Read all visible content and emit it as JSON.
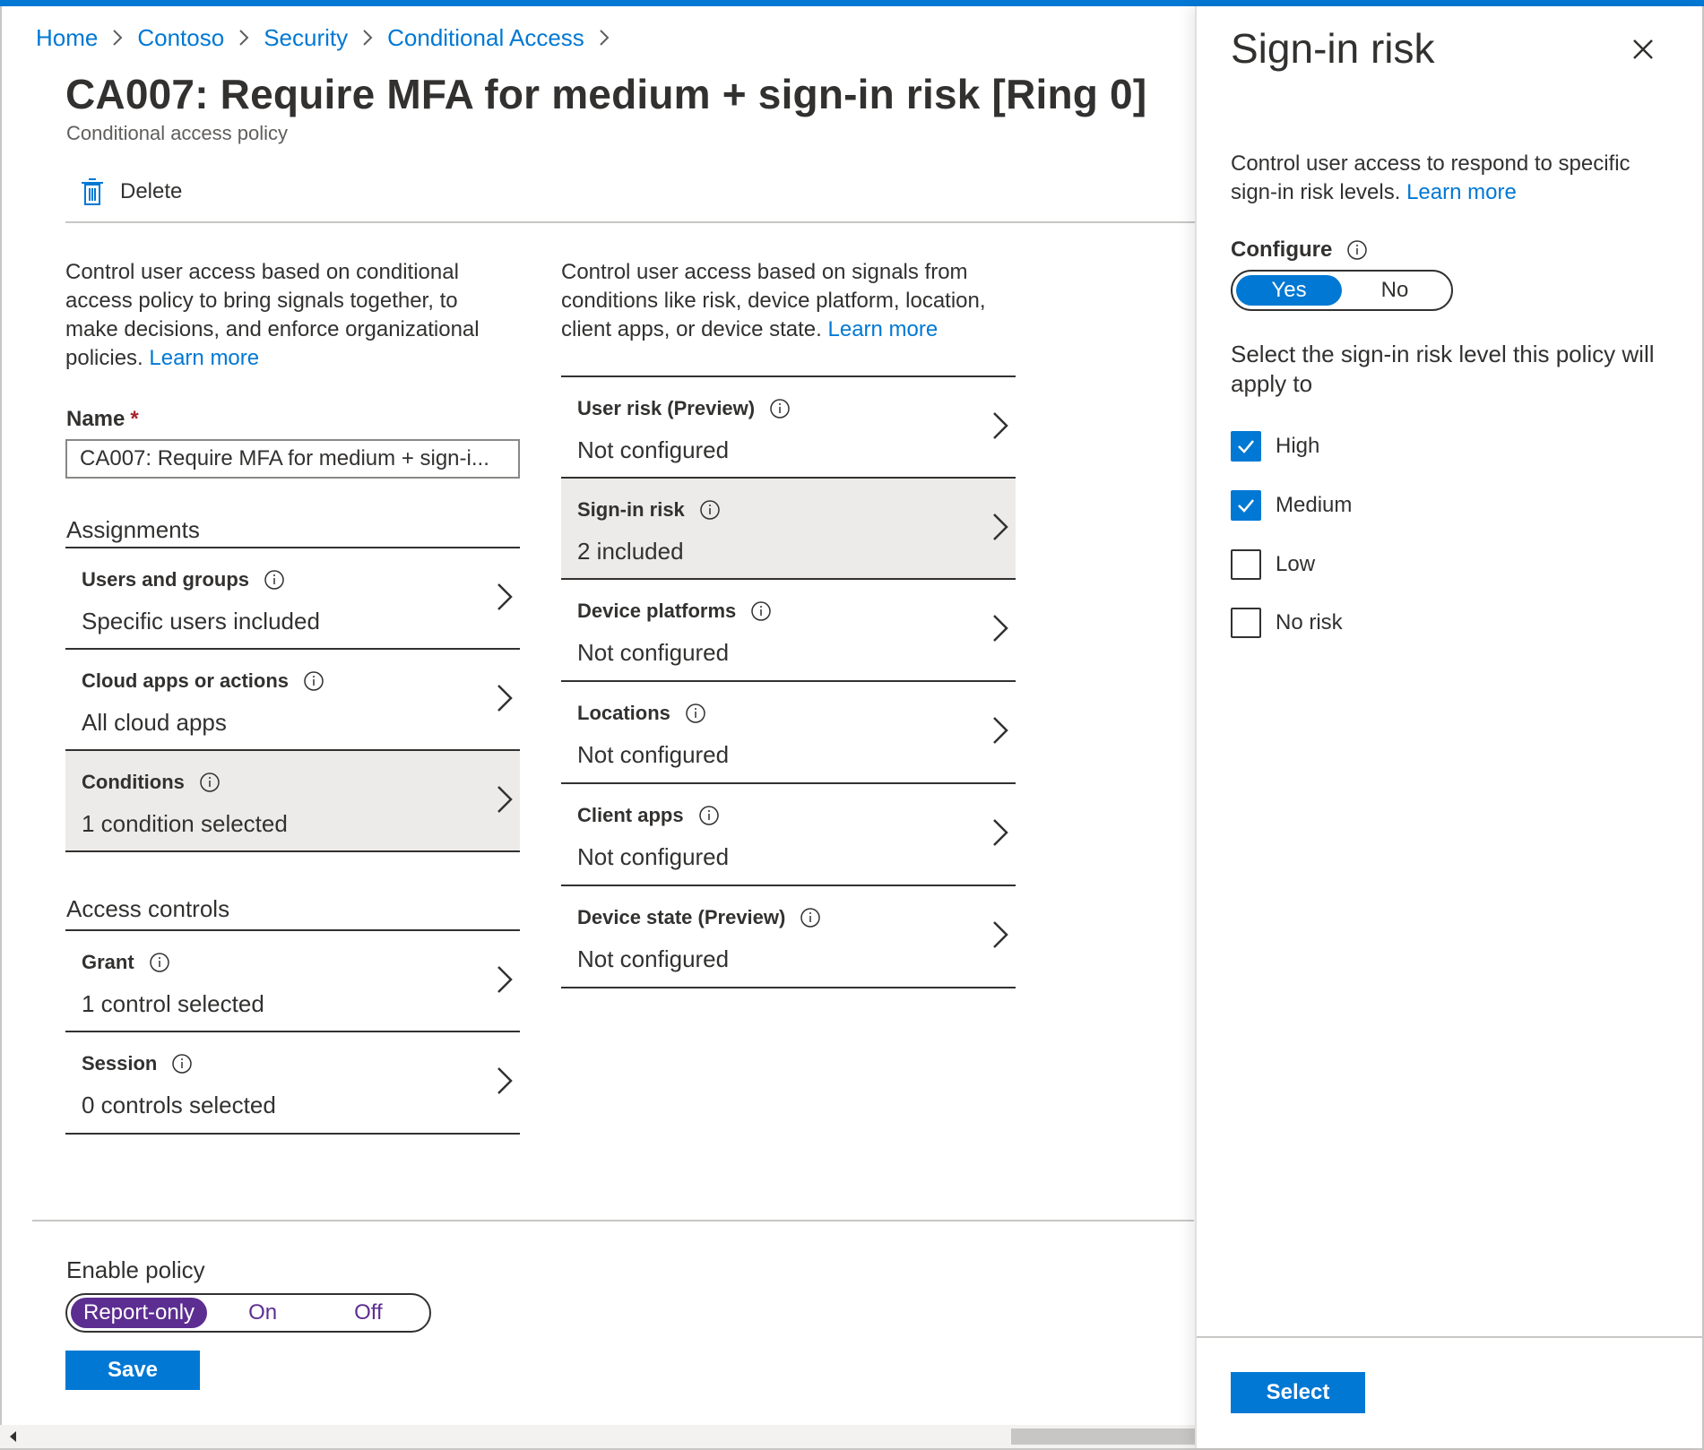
{
  "breadcrumb": [
    {
      "label": "Home"
    },
    {
      "label": "Contoso"
    },
    {
      "label": "Security"
    },
    {
      "label": "Conditional Access"
    }
  ],
  "page": {
    "title": "CA007: Require MFA for medium + sign-in risk [Ring 0]",
    "subtitle": "Conditional access policy"
  },
  "commands": {
    "delete_label": "Delete"
  },
  "left_desc": {
    "text": "Control user access based on conditional access policy to bring signals together, to make decisions, and enforce organizational policies.",
    "link": "Learn more"
  },
  "mid_desc": {
    "text": "Control user access based on signals from conditions like risk, device platform, location, client apps, or device state.",
    "link": "Learn more"
  },
  "name_field": {
    "label": "Name",
    "required_mark": "*",
    "value": "CA007: Require MFA for medium + sign-i..."
  },
  "assignments": {
    "heading": "Assignments",
    "items": [
      {
        "title": "Users and groups",
        "value": "Specific users included"
      },
      {
        "title": "Cloud apps or actions",
        "value": "All cloud apps"
      },
      {
        "title": "Conditions",
        "value": "1 condition selected"
      }
    ]
  },
  "access_controls": {
    "heading": "Access controls",
    "items": [
      {
        "title": "Grant",
        "value": "1 control selected"
      },
      {
        "title": "Session",
        "value": "0 controls selected"
      }
    ]
  },
  "conditions": {
    "items": [
      {
        "title": "User risk (Preview)",
        "value": "Not configured"
      },
      {
        "title": "Sign-in risk",
        "value": "2 included"
      },
      {
        "title": "Device platforms",
        "value": "Not configured"
      },
      {
        "title": "Locations",
        "value": "Not configured"
      },
      {
        "title": "Client apps",
        "value": "Not configured"
      },
      {
        "title": "Device state (Preview)",
        "value": "Not configured"
      }
    ]
  },
  "enable_policy": {
    "label": "Enable policy",
    "options": [
      "Report-only",
      "On",
      "Off"
    ],
    "selected": "Report-only"
  },
  "save_label": "Save",
  "blade": {
    "title": "Sign-in risk",
    "desc": "Control user access to respond to specific sign-in risk levels.",
    "desc_link": "Learn more",
    "configure_label": "Configure",
    "configure_options": [
      "Yes",
      "No"
    ],
    "configure_selected": "Yes",
    "select_label": "Select the sign-in risk level this policy will apply to",
    "risk_levels": [
      {
        "label": "High",
        "checked": true
      },
      {
        "label": "Medium",
        "checked": true
      },
      {
        "label": "Low",
        "checked": false
      },
      {
        "label": "No risk",
        "checked": false
      }
    ],
    "select_button": "Select"
  },
  "colors": {
    "accent": "#0078d4",
    "report_only": "#5c2e91",
    "selected_row": "#edebe9"
  }
}
